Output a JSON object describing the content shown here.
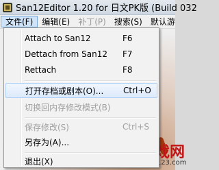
{
  "window": {
    "title": "San12Editor 1.20 for 日文PK版 (Build 032"
  },
  "menubar": {
    "items": [
      {
        "label": "文件(F)",
        "state": "active"
      },
      {
        "label": "编辑(E)",
        "state": "normal"
      },
      {
        "label": "补丁(P)",
        "state": "disabled"
      },
      {
        "label": "搜索(S)",
        "state": "normal"
      },
      {
        "label": "默认游戏",
        "state": "normal"
      }
    ]
  },
  "file_menu": {
    "items": [
      {
        "label": "Attach to San12",
        "shortcut": "F6",
        "enabled": true
      },
      {
        "label": "Dettach from San12",
        "shortcut": "F7",
        "enabled": true
      },
      {
        "label": "Rettach",
        "shortcut": "F8",
        "enabled": true
      },
      {
        "label": "打开存档或剧本(O)...",
        "shortcut": "Ctrl+O",
        "enabled": true,
        "highlighted": true
      },
      {
        "label": "切换回内存修改模式(B)",
        "shortcut": "",
        "enabled": false
      },
      {
        "label": "保存修改(S)",
        "shortcut": "Ctrl+S",
        "enabled": false
      },
      {
        "label": "另存为(A)...",
        "shortcut": "",
        "enabled": true
      },
      {
        "label": "退出(X)",
        "shortcut": "",
        "enabled": true
      }
    ]
  },
  "watermark": {
    "text": "牧羊游戏网",
    "url": "www.mygame123.com"
  },
  "colors": {
    "menu_background": "#f2f2f2",
    "highlight_border": "#aecff7",
    "disabled_text": "#a0a0a0",
    "watermark": "#c41414"
  },
  "icons": {
    "app": "app-icon"
  }
}
